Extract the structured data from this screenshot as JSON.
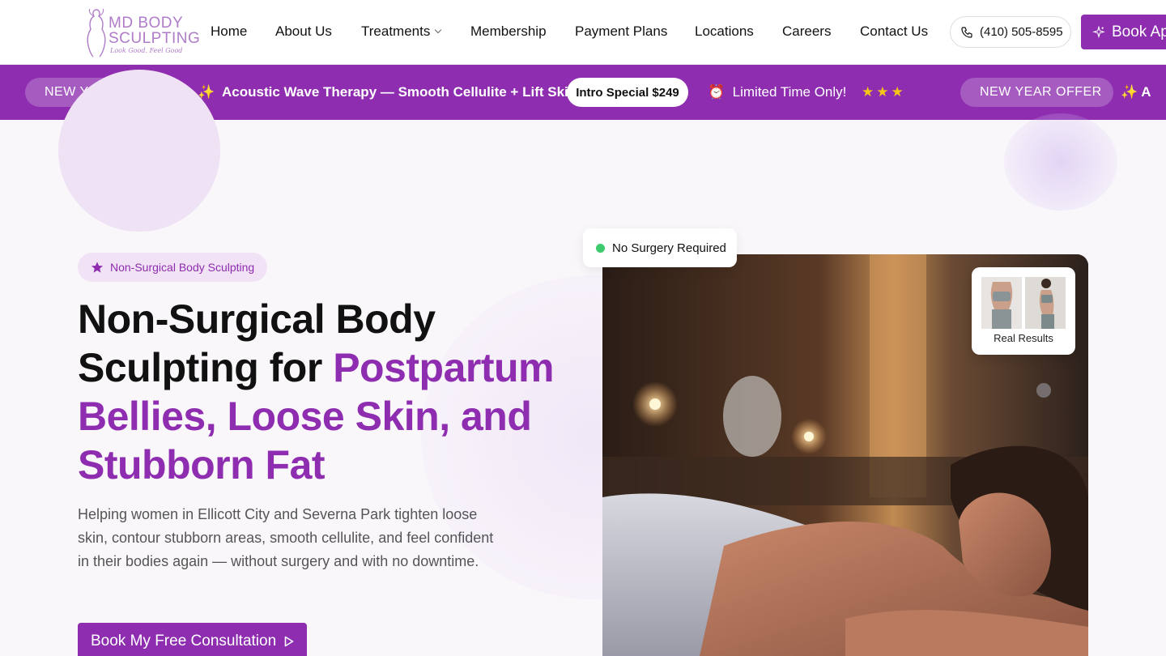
{
  "header": {
    "logo": {
      "line1": "MD BODY",
      "line2": "SCULPTING",
      "tagline": "Look Good. Feel Good"
    },
    "nav": [
      {
        "label": "Home"
      },
      {
        "label": "About Us"
      },
      {
        "label": "Treatments",
        "has_dropdown": true
      },
      {
        "label": "Membership"
      },
      {
        "label": "Payment Plans"
      },
      {
        "label": "Locations"
      },
      {
        "label": "Careers"
      },
      {
        "label": "Contact Us"
      }
    ],
    "phone": "(410) 505-8595",
    "book_label": "Book Ap"
  },
  "promo": {
    "offer_label": "NEW YEAR OFFER",
    "offer_icon": "sparkles-icon",
    "headline": "Acoustic Wave Therapy — Smooth Cellulite + Lift Skin",
    "intro_special": "Intro Special $249",
    "timer_icon": "alarm-clock-icon",
    "limited": "Limited Time Only!",
    "stars": "★★★",
    "repeat_offer_label": "NEW YEAR OFFER",
    "repeat_tail": "A",
    "colors": {
      "bar": "#8e2db0",
      "star": "#f5c518"
    }
  },
  "hero": {
    "badge": "Non-Surgical Body Sculpting",
    "title_plain_1": "Non-Surgical Body",
    "title_plain_2": "Sculpting for ",
    "title_accent_1": "Postpartum",
    "title_accent_2": "Bellies, Loose Skin, and",
    "title_accent_3": "Stubborn Fat",
    "description": "Helping women in Ellicott City and Severna Park tighten loose skin, contour stubborn areas, smooth cellulite, and feel confident in their bodies again — without surgery and with no downtime.",
    "cta_label": "Book My Free Consultation",
    "no_surgery": "No Surgery Required",
    "real_results": "Real Results",
    "colors": {
      "accent": "#8e2db0",
      "success_dot": "#3ccb6e"
    }
  }
}
